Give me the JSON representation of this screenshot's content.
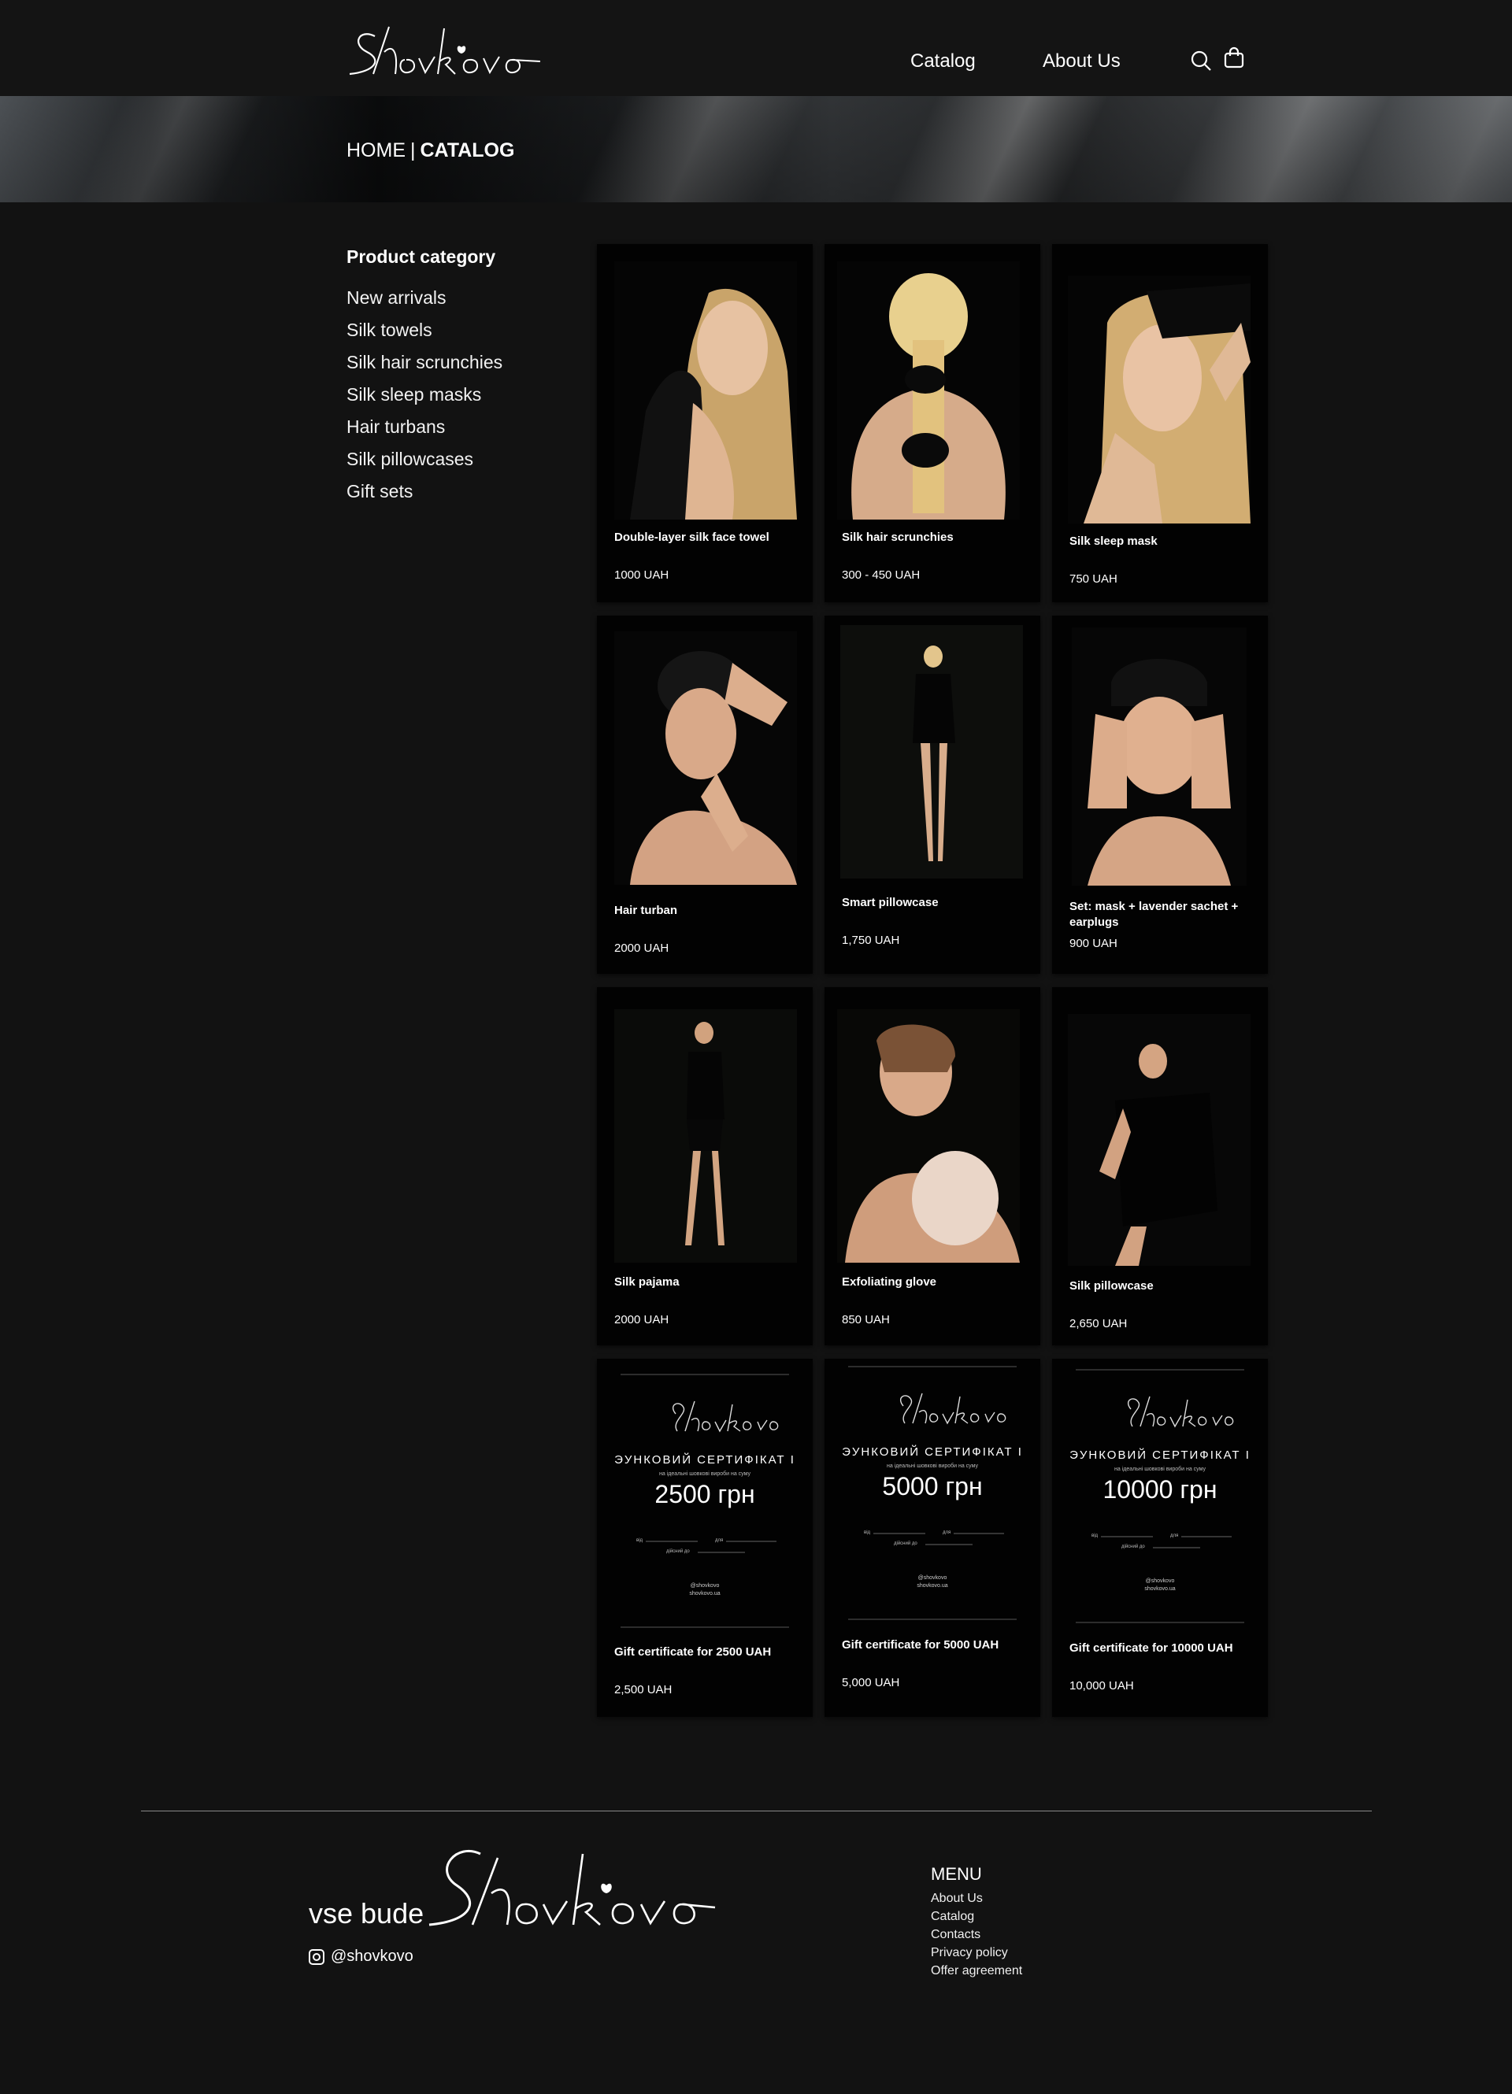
{
  "header": {
    "logo_text": "Shovkovo",
    "nav": [
      {
        "label": "Catalog"
      },
      {
        "label": "About Us"
      }
    ],
    "icons": [
      "search-icon",
      "shopping-bag-icon"
    ]
  },
  "breadcrumb": {
    "home": "HOME",
    "separator": "|",
    "current": "CATALOG"
  },
  "sidebar": {
    "title": "Product category",
    "items": [
      {
        "label": "New arrivals"
      },
      {
        "label": "Silk towels"
      },
      {
        "label": "Silk hair scrunchies"
      },
      {
        "label": "Silk sleep masks"
      },
      {
        "label": "Hair turbans"
      },
      {
        "label": "Silk pillowcases"
      },
      {
        "label": "Gift sets"
      }
    ]
  },
  "products": [
    {
      "name": "Double-layer silk face towel",
      "price": "1000 UAH"
    },
    {
      "name": "Silk hair scrunchies",
      "price": "300 - 450 UAH"
    },
    {
      "name": "Silk sleep mask",
      "price": "750 UAH"
    },
    {
      "name": "Hair turban",
      "price": "2000 UAH"
    },
    {
      "name": "Smart pillowcase",
      "price": "1,750 UAH"
    },
    {
      "name": "Set: mask + lavender sachet + earplugs",
      "price": "900 UAH"
    },
    {
      "name": "Silk pajama",
      "price": "2000 UAH"
    },
    {
      "name": "Exfoliating glove",
      "price": "850 UAH"
    },
    {
      "name": "Silk pillowcase",
      "price": "2,650 UAH"
    },
    {
      "name": "Gift certificate for 2500 UAH",
      "price": "2,500 UAH"
    },
    {
      "name": "Gift certificate for 5000 UAH",
      "price": "5,000 UAH"
    },
    {
      "name": "Gift certificate for 10000 UAH",
      "price": "10,000 UAH"
    }
  ],
  "certificates": [
    {
      "heading": "ЭУНКОВИЙ СЕРТИФІКАТ І",
      "sub": "на ідеальні шовкові вироби на суму",
      "amount": "2500 грн",
      "from": "від",
      "to": "для",
      "valid": "дійсний до",
      "handle1": "@shovkovo",
      "handle2": "shovkovo.ua"
    },
    {
      "heading": "ЭУНКОВИЙ СЕРТИФІКАТ І",
      "sub": "на ідеальні шовкові вироби на суму",
      "amount": "5000 грн",
      "from": "від",
      "to": "для",
      "valid": "дійсний до",
      "handle1": "@shovkovo",
      "handle2": "shovkovo.ua"
    },
    {
      "heading": "ЭУНКОВИЙ СЕРТИФІКАТ І",
      "sub": "на ідеальні шовкові вироби на суму",
      "amount": "10000 грн",
      "from": "від",
      "to": "для",
      "valid": "дійсний до",
      "handle1": "@shovkovo",
      "handle2": "shovkovo.ua"
    }
  ],
  "footer": {
    "tagline": "vse bude",
    "logo_text": "Shovkovo",
    "instagram": "@shovkovo",
    "menu_title": "MENU",
    "menu": [
      {
        "label": "About Us"
      },
      {
        "label": "Catalog"
      },
      {
        "label": "Contacts"
      },
      {
        "label": "Privacy policy"
      },
      {
        "label": "Offer agreement"
      }
    ]
  },
  "colors": {
    "background": "#121212",
    "card": "#020202",
    "text": "#ffffff"
  }
}
